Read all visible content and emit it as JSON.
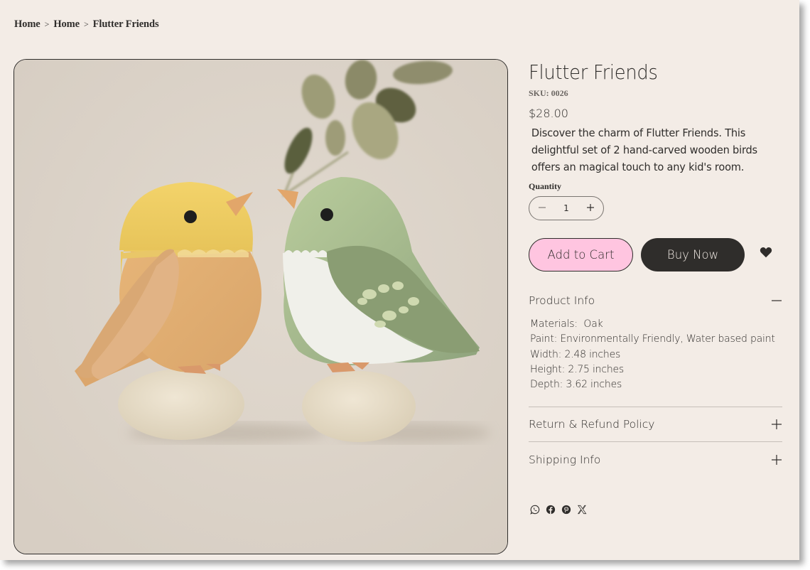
{
  "breadcrumb": [
    {
      "label": "Home"
    },
    {
      "label": "Home"
    },
    {
      "label": "Flutter Friends"
    }
  ],
  "breadcrumb_separator": ">",
  "product": {
    "title": "Flutter Friends",
    "sku": "SKU: 0026",
    "price": "$28.00",
    "description": "Discover the charm of Flutter Friends. This delightful set of 2 hand-carved wooden birds offers an magical touch to any kid's room.",
    "image_alt": "Two wooden toy birds, one yellow and one green, perched on round wooden bases with leaves above"
  },
  "quantity": {
    "label": "Quantity",
    "value": "1",
    "decrement_icon": "minus-icon",
    "increment_icon": "plus-icon"
  },
  "actions": {
    "add_to_cart": "Add to Cart",
    "buy_now": "Buy Now",
    "wishlist_icon": "heart-icon"
  },
  "accordions": [
    {
      "title": "Product Info",
      "expanded": true,
      "toggle": "minus-icon",
      "lines": [
        "Materials:  Oak",
        "Paint: Environmentally Friendly, Water based paint",
        "Width: 2.48 inches",
        "Height: 2.75 inches",
        "Depth: 3.62 inches"
      ]
    },
    {
      "title": "Return & Refund Policy",
      "expanded": false,
      "toggle": "plus-icon"
    },
    {
      "title": "Shipping Info",
      "expanded": false,
      "toggle": "plus-icon"
    }
  ],
  "share": [
    "whatsapp-icon",
    "facebook-icon",
    "pinterest-icon",
    "x-icon"
  ],
  "colors": {
    "background": "#f3ece6",
    "text": "#2f2d2b",
    "add_to_cart_bg": "#ffc5e0",
    "buy_now_bg": "#2f2d2b",
    "image_bg": "#dbd2c8"
  }
}
